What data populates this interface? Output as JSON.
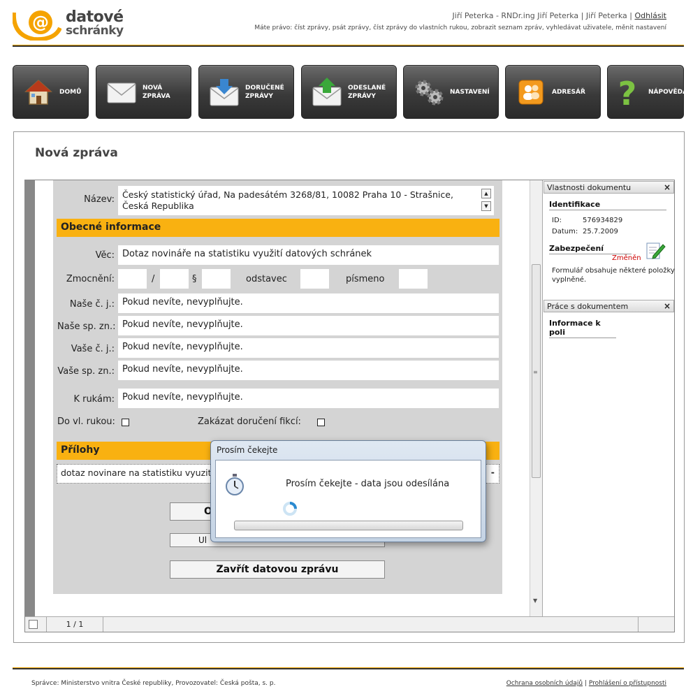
{
  "header": {
    "logo_line1": "datové",
    "logo_line2": "schránky",
    "user": "Jiří Peterka - RNDr.ing Jiří Peterka | Jiří Peterka |",
    "logout": "Odhlásit",
    "rights": "Máte právo: číst zprávy, psát zprávy, číst zprávy do vlastních rukou, zobrazit seznam zpráv, vyhledávat uživatele, měnit nastavení"
  },
  "nav": [
    {
      "label": "DOMŮ",
      "icon": "house-icon"
    },
    {
      "label": "NOVÁ\nZPRÁVA",
      "icon": "envelope-icon"
    },
    {
      "label": "DORUČENÉ\nZPRÁVY",
      "icon": "inbox-download-icon"
    },
    {
      "label": "ODESLANÉ\nZPRÁVY",
      "icon": "outbox-upload-icon"
    },
    {
      "label": "NASTAVENÍ",
      "icon": "gears-icon"
    },
    {
      "label": "ADRESÁŘ",
      "icon": "address-book-icon"
    },
    {
      "label": "NÁPOVĚDA",
      "icon": "help-question-icon"
    }
  ],
  "page_title": "Nová zpráva",
  "form": {
    "nazev_label": "Název:",
    "nazev_value": "Český statistický úřad, Na padesátém 3268/81, 10082 Praha 10 - Strašnice, Česká Republika",
    "section_general": "Obecné informace",
    "vec_label": "Věc:",
    "vec_value": "Dotaz novináře na statistiku využití datových schránek",
    "zmocneni_label": "Zmocnění:",
    "slash": "/",
    "paragraph": "§",
    "odstavec": "odstavec",
    "pismeno": "písmeno",
    "nase_cj_label": "Naše č. j.:",
    "nase_spzn_label": "Naše sp. zn.:",
    "vase_cj_label": "Vaše č. j.:",
    "vase_spzn_label": "Vaše sp. zn.:",
    "k_rukam_label": "K rukám:",
    "placeholder_value": "Pokud nevíte, nevyplňujte.",
    "do_vl_rukou": "Do vl. rukou:",
    "zakazat": "Zakázat doručení fikcí:",
    "section_attachments": "Přílohy",
    "attachment_name": "dotaz novinare na statistiku vyuzití",
    "attachment_minus": "-",
    "btn1": "O",
    "btn2": "Ul",
    "btn_close": "Zavřít datovou zprávu"
  },
  "side": {
    "props_title": "Vlastnosti dokumentu",
    "identification": "Identifikace",
    "id_label": "ID:",
    "id_value": "576934829",
    "date_label": "Datum:",
    "date_value": "25.7.2009",
    "security": "Zabezpečení",
    "changed": "Změněn",
    "form_note_1": "Formulář obsahuje některé položky",
    "form_note_2": "vyplněné.",
    "work_title": "Práce s dokumentem",
    "field_info": "Informace k poli",
    "close": "×"
  },
  "statusbar": {
    "pages": "1 / 1"
  },
  "modal": {
    "title": "Prosím čekejte",
    "message": "Prosím čekejte - data jsou odesílána"
  },
  "footer": {
    "left": "Správce: Ministerstvo vnitra České republiky, Provozovatel: Česká pošta, s. p.",
    "privacy": "Ochrana osobních údajů",
    "separator": "|",
    "accessibility": "Prohlášení o přístupnosti"
  },
  "colors": {
    "accent": "#f9b111",
    "nav_dark": "#333333",
    "link": "#333333"
  }
}
